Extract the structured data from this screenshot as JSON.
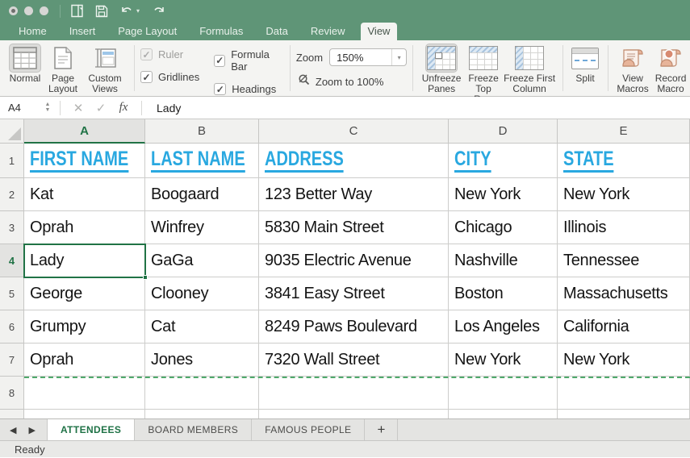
{
  "titlebar": {
    "traffic_lights": [
      "close",
      "minimize",
      "zoom"
    ],
    "quick_access": [
      "new-workbook",
      "save",
      "undo",
      "redo"
    ]
  },
  "ribbon_tabs": {
    "items": [
      {
        "label": "Home",
        "active": false
      },
      {
        "label": "Insert",
        "active": false
      },
      {
        "label": "Page Layout",
        "active": false
      },
      {
        "label": "Formulas",
        "active": false
      },
      {
        "label": "Data",
        "active": false
      },
      {
        "label": "Review",
        "active": false
      },
      {
        "label": "View",
        "active": true
      }
    ]
  },
  "ribbon": {
    "views_group": {
      "buttons": [
        {
          "label": "Normal",
          "selected": true
        },
        {
          "label": "Page Layout",
          "selected": false
        },
        {
          "label": "Custom Views",
          "selected": false
        }
      ]
    },
    "show_group": {
      "checkboxes": [
        {
          "label": "Ruler",
          "checked": true,
          "disabled": true
        },
        {
          "label": "Gridlines",
          "checked": true,
          "disabled": false
        },
        {
          "label": "Formula Bar",
          "checked": true,
          "disabled": false
        },
        {
          "label": "Headings",
          "checked": true,
          "disabled": false
        }
      ]
    },
    "zoom_group": {
      "label": "Zoom",
      "value": "150%",
      "zoom_to_100": "Zoom to 100%"
    },
    "freeze_group": {
      "buttons": [
        {
          "label": "Unfreeze Panes",
          "selected": true
        },
        {
          "label": "Freeze Top Row",
          "selected": false
        },
        {
          "label": "Freeze First Column",
          "selected": false
        }
      ]
    },
    "window_group": {
      "split": "Split"
    },
    "macros_group": {
      "buttons": [
        {
          "label": "View Macros"
        },
        {
          "label": "Record Macro"
        }
      ]
    }
  },
  "formula_bar": {
    "name_box": "A4",
    "fx_label": "fx",
    "content": "Lady"
  },
  "sheet": {
    "column_letters": [
      "A",
      "B",
      "C",
      "D",
      "E"
    ],
    "selected_column": "A",
    "selected_row": 4,
    "active_cell": "A4",
    "header_row": [
      "FIRST NAME",
      "LAST NAME",
      "ADDRESS",
      "CITY",
      "STATE"
    ],
    "data_rows": [
      [
        "Kat",
        "Boogaard",
        "123 Better Way",
        "New York",
        "New York"
      ],
      [
        "Oprah",
        "Winfrey",
        "5830 Main Street",
        "Chicago",
        "Illinois"
      ],
      [
        "Lady",
        "GaGa",
        "9035 Electric Avenue",
        "Nashville",
        "Tennessee"
      ],
      [
        "George",
        "Clooney",
        "3841 Easy Street",
        "Boston",
        "Massachusetts"
      ],
      [
        "Grumpy",
        "Cat",
        "8249 Paws Boulevard",
        "Los Angeles",
        "California"
      ],
      [
        "Oprah",
        "Jones",
        "7320 Wall Street",
        "New York",
        "New York"
      ]
    ],
    "visible_row_numbers": [
      1,
      2,
      3,
      4,
      5,
      6,
      7,
      8
    ]
  },
  "sheet_tabs": {
    "tabs": [
      {
        "label": "ATTENDEES",
        "active": true
      },
      {
        "label": "BOARD MEMBERS",
        "active": false
      },
      {
        "label": "FAMOUS PEOPLE",
        "active": false
      }
    ],
    "add_label": "+"
  },
  "status_bar": {
    "text": "Ready"
  },
  "colors": {
    "titlebar_green": "#5f9577",
    "accent_green": "#217346",
    "header_blue": "#29a8e0",
    "page_break_green": "#4fa96b"
  }
}
